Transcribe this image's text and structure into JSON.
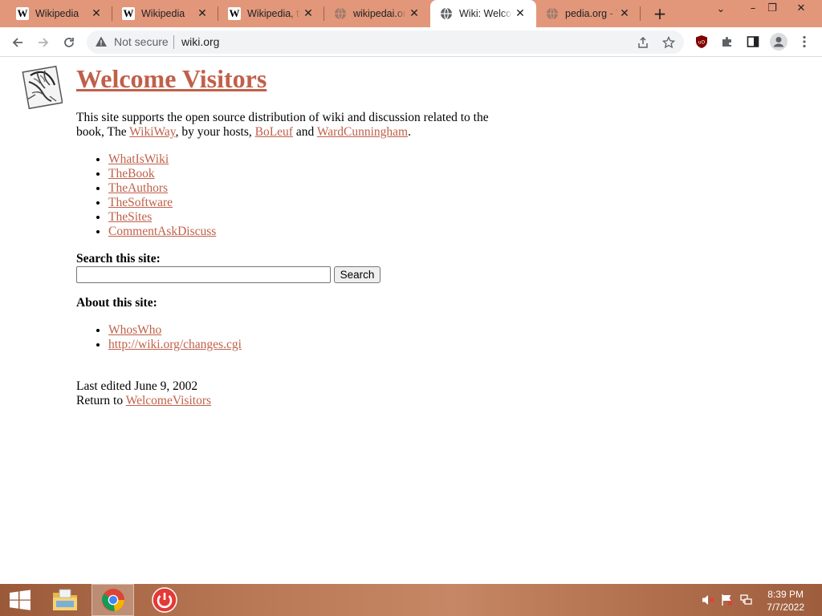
{
  "browser": {
    "tabs": [
      {
        "title": "Wikipedia",
        "favicon": "wikipedia-w-icon",
        "active": false
      },
      {
        "title": "Wikipedia",
        "favicon": "wikipedia-w-icon",
        "active": false
      },
      {
        "title": "Wikipedia, th",
        "favicon": "wikipedia-w-icon",
        "active": false
      },
      {
        "title": "wikipedai.org",
        "favicon": "globe-icon",
        "active": false
      },
      {
        "title": "Wiki: Welcom",
        "favicon": "globe-icon",
        "active": true
      },
      {
        "title": "pedia.org - T",
        "favicon": "globe-icon",
        "active": false
      }
    ],
    "close_glyph": "✕",
    "new_tab_glyph": "+",
    "window_controls": {
      "dropdown": "⌄",
      "minimize": "–",
      "restore": "❐",
      "close": "✕"
    },
    "toolbar": {
      "security_label": "Not secure",
      "url": "wiki.org"
    },
    "colors": {
      "tab_strip": "#e2977a",
      "link": "#c0604a"
    }
  },
  "page": {
    "heading": "Welcome Visitors",
    "intro": {
      "text1": "This site supports the open source distribution of wiki and discussion related to the book, The ",
      "link1": "WikiWay",
      "text2": ", by your hosts, ",
      "link2": "BoLeuf",
      "text3": " and ",
      "link3": "WardCunningham",
      "text4": "."
    },
    "main_links": [
      "WhatIsWiki",
      "TheBook",
      "TheAuthors",
      "TheSoftware",
      "TheSites",
      "CommentAskDiscuss"
    ],
    "search": {
      "title": "Search this site:",
      "value": "",
      "button_label": "Search"
    },
    "about": {
      "title": "About this site:",
      "links": [
        "WhosWho",
        "http://wiki.org/changes.cgi"
      ]
    },
    "footer": {
      "last_edited": "Last edited June 9, 2002",
      "return_text": "Return to ",
      "return_link": "WelcomeVisitors"
    }
  },
  "taskbar": {
    "pinned": [
      "start-icon",
      "file-explorer-icon",
      "chrome-icon",
      "power-app-icon"
    ],
    "tray": [
      "volume-muted-icon",
      "action-center-flag-icon",
      "network-icon"
    ],
    "time": "8:39 PM",
    "date": "7/7/2022"
  }
}
